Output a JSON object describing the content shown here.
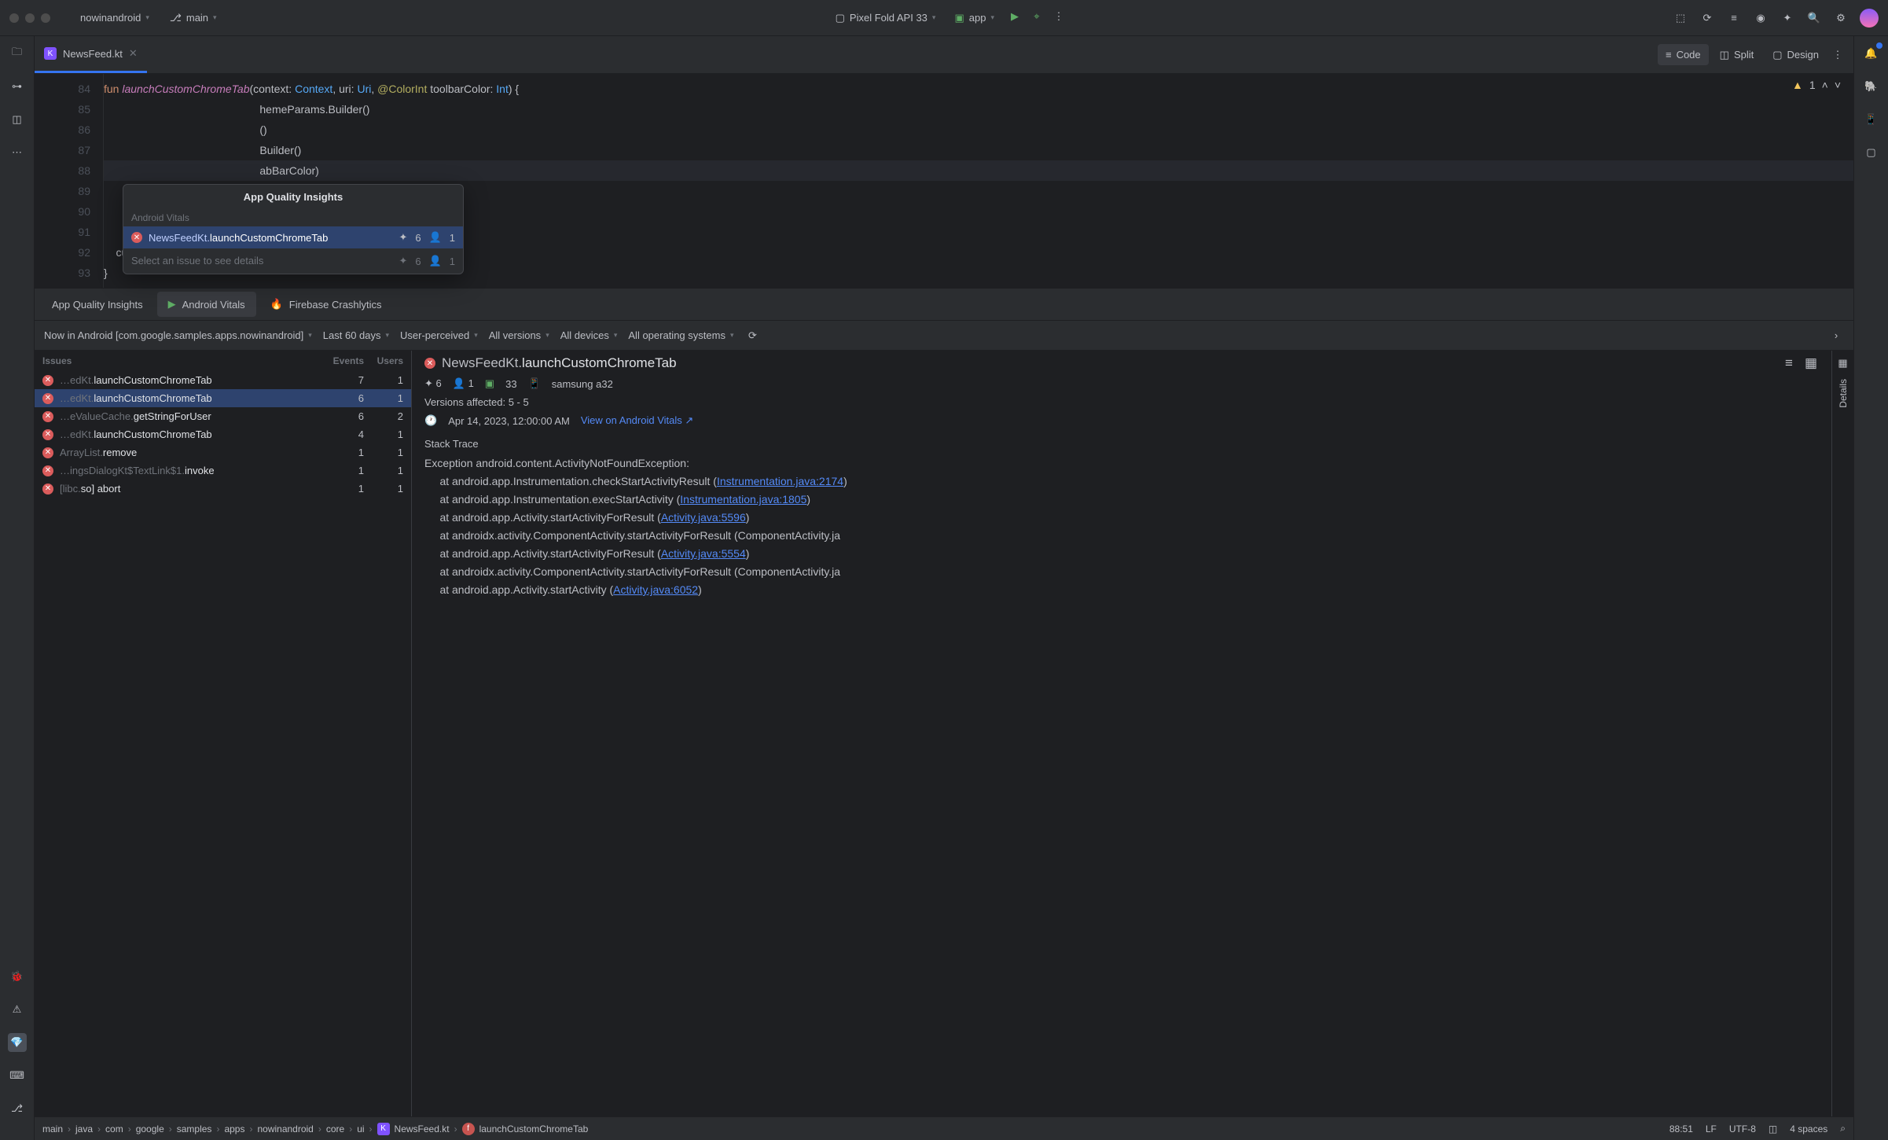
{
  "titlebar": {
    "project": "nowinandroid",
    "branch": "main",
    "device": "Pixel Fold API 33",
    "runConfig": "app"
  },
  "tabs": {
    "file": "NewsFeed.kt"
  },
  "viewModes": {
    "code": "Code",
    "split": "Split",
    "design": "Design"
  },
  "inspectionCount": "1",
  "gutter": [
    "84",
    "85",
    "86",
    "87",
    "88",
    "89",
    "90",
    "91",
    "92",
    "93"
  ],
  "popup": {
    "title": "App Quality Insights",
    "section": "Android Vitals",
    "row": {
      "file": "NewsFeedKt.",
      "method": "launchCustomChromeTab",
      "events": "6",
      "users": "1"
    },
    "hint": "Select an issue to see details",
    "hintEvents": "6",
    "hintUsers": "1"
  },
  "bottomTabs": {
    "aqi": "App Quality Insights",
    "vitals": "Android Vitals",
    "crashlytics": "Firebase Crashlytics"
  },
  "filters": {
    "app": "Now in Android [com.google.samples.apps.nowinandroid]",
    "range": "Last 60 days",
    "perceived": "User-perceived",
    "versions": "All versions",
    "devices": "All devices",
    "os": "All operating systems"
  },
  "issuesHeader": {
    "c1": "Issues",
    "c2": "Events",
    "c3": "Users"
  },
  "issues": [
    {
      "pre": "…edKt.",
      "m": "launchCustomChromeTab",
      "e": "7",
      "u": "1"
    },
    {
      "pre": "…edKt.",
      "m": "launchCustomChromeTab",
      "e": "6",
      "u": "1"
    },
    {
      "pre": "…eValueCache.",
      "m": "getStringForUser",
      "e": "6",
      "u": "2"
    },
    {
      "pre": "…edKt.",
      "m": "launchCustomChromeTab",
      "e": "4",
      "u": "1"
    },
    {
      "pre": "ArrayList.",
      "m": "remove",
      "e": "1",
      "u": "1"
    },
    {
      "pre": "…ingsDialogKt$TextLink$1.",
      "m": "invoke",
      "e": "1",
      "u": "1"
    },
    {
      "pre": "[libc.",
      "m": "so] abort",
      "e": "1",
      "u": "1"
    }
  ],
  "detail": {
    "class": "NewsFeedKt.",
    "method": "launchCustomChromeTab",
    "events": "6",
    "users": "1",
    "api": "33",
    "device": "samsung a32",
    "versions": "Versions affected: 5 - 5",
    "timestamp": "Apr 14, 2023, 12:00:00 AM",
    "link": "View on Android Vitals",
    "traceLabel": "Stack Trace"
  },
  "trace": {
    "l0": "Exception android.content.ActivityNotFoundException:",
    "l1a": "     at android.app.Instrumentation.checkStartActivityResult (",
    "l1b": "Instrumentation.java:2174",
    "l1c": ")",
    "l2a": "     at android.app.Instrumentation.execStartActivity (",
    "l2b": "Instrumentation.java:1805",
    "l2c": ")",
    "l3a": "     at android.app.Activity.startActivityForResult (",
    "l3b": "Activity.java:5596",
    "l3c": ")",
    "l4": "     at androidx.activity.ComponentActivity.startActivityForResult (ComponentActivity.ja",
    "l5a": "     at android.app.Activity.startActivityForResult (",
    "l5b": "Activity.java:5554",
    "l5c": ")",
    "l6": "     at androidx.activity.ComponentActivity.startActivityForResult (ComponentActivity.ja",
    "l7a": "     at android.app.Activity.startActivity (",
    "l7b": "Activity.java:6052",
    "l7c": ")"
  },
  "detailsTab": "Details",
  "crumbs": [
    "main",
    "java",
    "com",
    "google",
    "samples",
    "apps",
    "nowinandroid",
    "core",
    "ui"
  ],
  "crumbFile": "NewsFeed.kt",
  "crumbFn": "launchCustomChromeTab",
  "status": {
    "pos": "88:51",
    "lf": "LF",
    "enc": "UTF-8",
    "indent": "4 spaces"
  }
}
